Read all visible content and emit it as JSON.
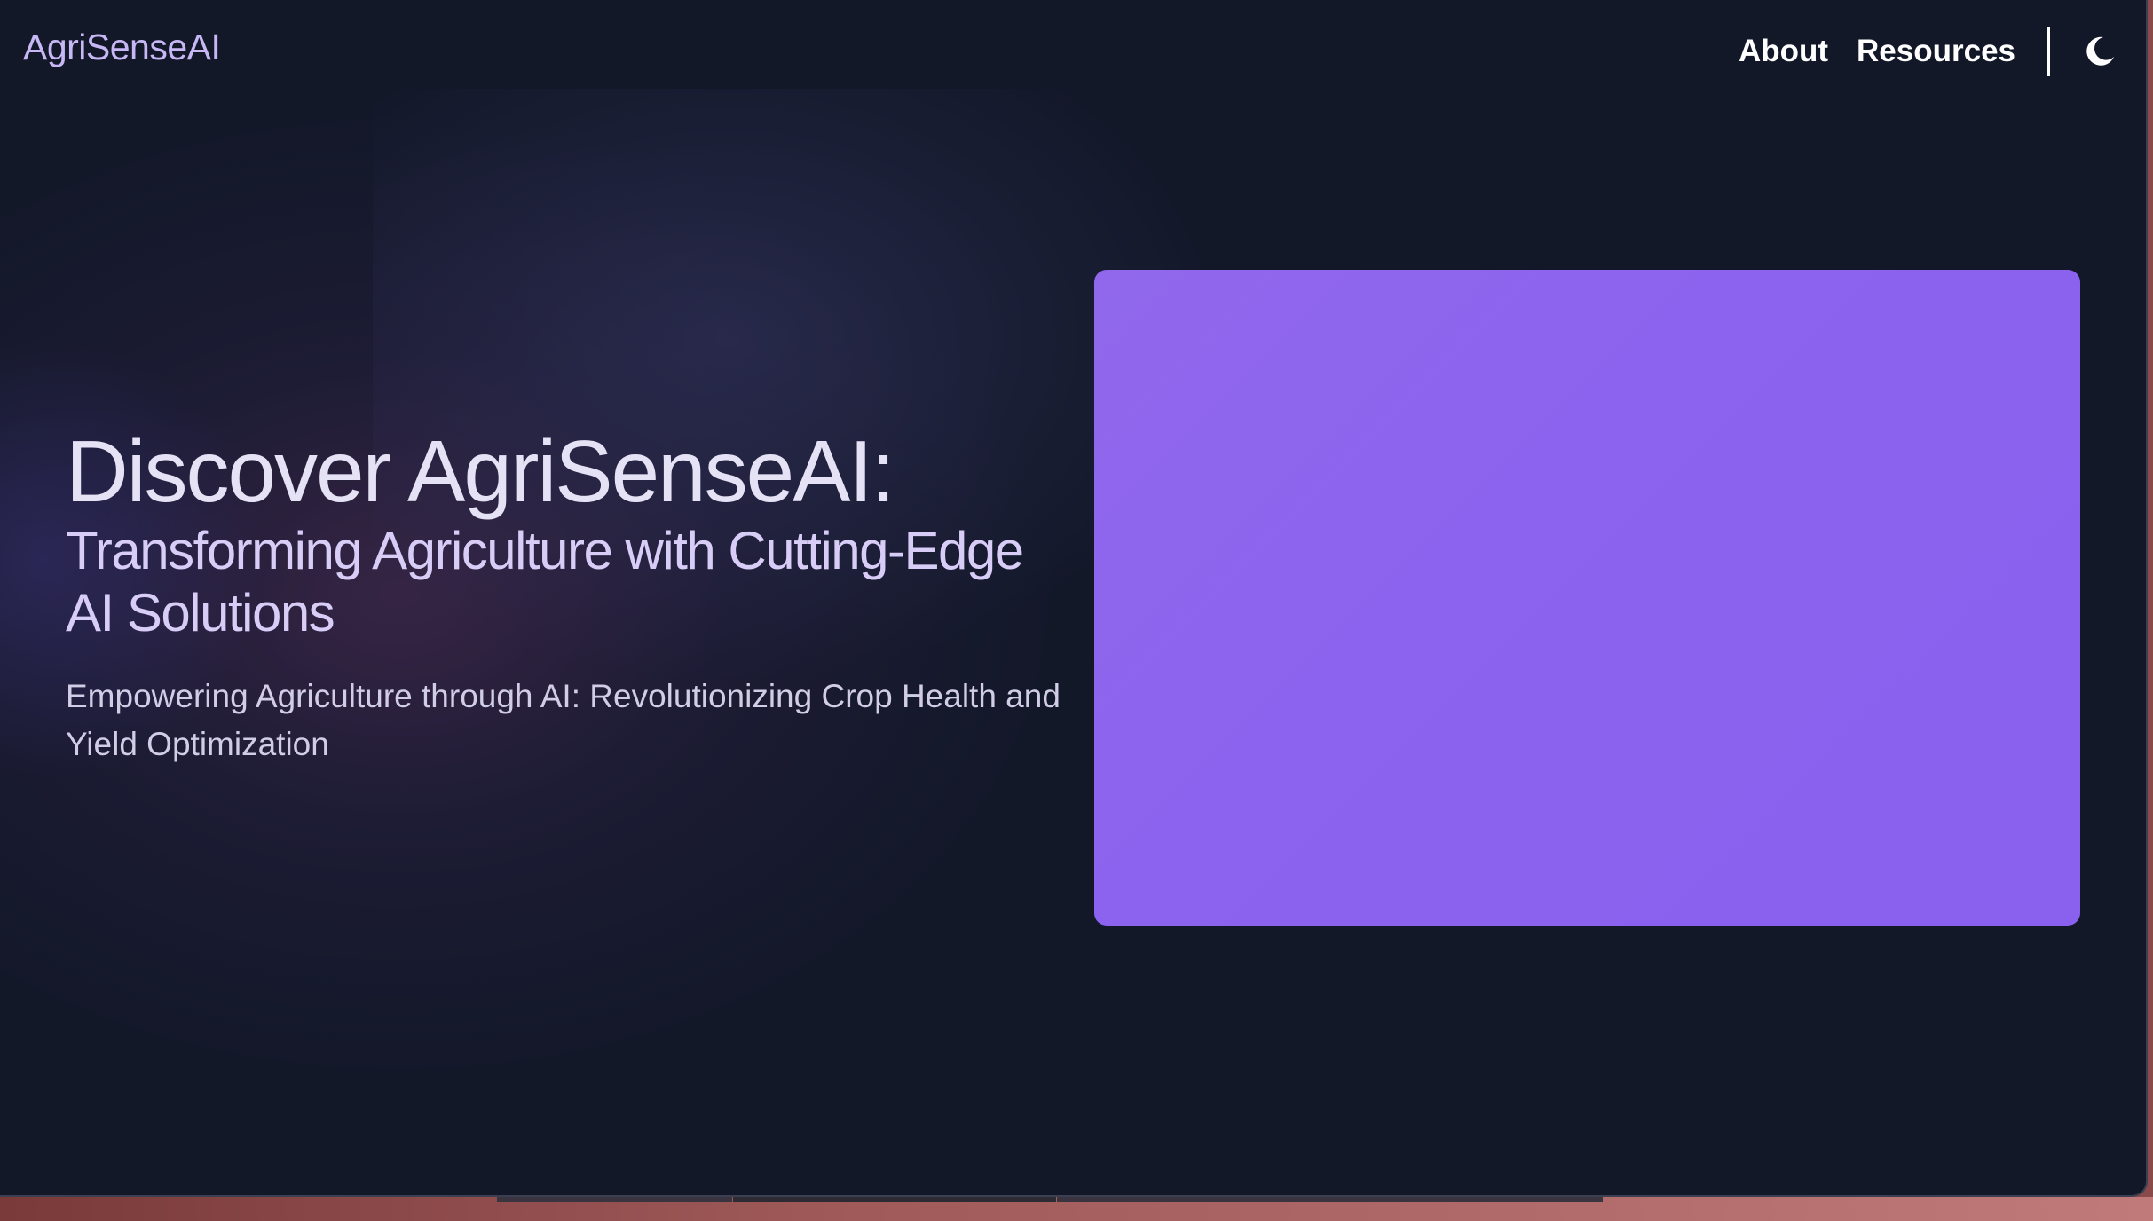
{
  "navbar": {
    "logo": "AgriSenseAI",
    "links": [
      {
        "label": "About"
      },
      {
        "label": "Resources"
      }
    ],
    "theme_toggle_icon": "moon-icon"
  },
  "hero": {
    "title": "Discover AgriSenseAI:",
    "subtitle": "Transforming Agriculture with Cutting-Edge AI Solutions",
    "tagline": "Empowering Agriculture through AI: Revolutionizing Crop Health and Yield Optimization"
  },
  "colors": {
    "background": "#131829",
    "logo": "#c7b8f5",
    "media_placeholder": "#8b63ee"
  }
}
